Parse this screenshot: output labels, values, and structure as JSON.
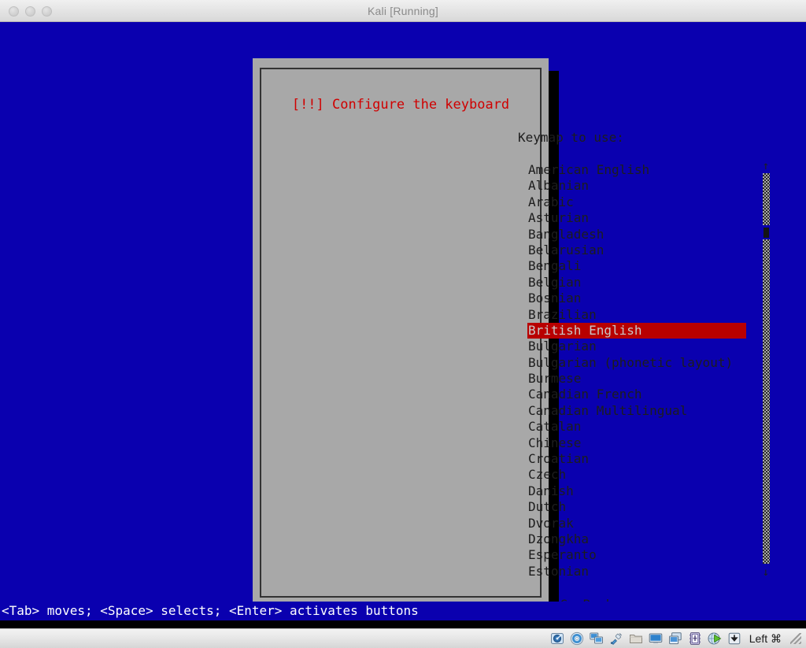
{
  "window": {
    "title": "Kali [Running]",
    "traffic_lights": [
      "close",
      "minimize",
      "zoom"
    ]
  },
  "dialog": {
    "title": "[!!] Configure the keyboard",
    "title_color": "#d00000",
    "prompt": "Keymap to use:",
    "background_color": "#a8a8a8",
    "items": [
      "American English",
      "Albanian",
      "Arabic",
      "Asturian",
      "Bangladesh",
      "Belarusian",
      "Bengali",
      "Belgian",
      "Bosnian",
      "Brazilian",
      "British English",
      "Bulgarian",
      "Bulgarian (phonetic layout)",
      "Burmese",
      "Canadian French",
      "Canadian Multilingual",
      "Catalan",
      "Chinese",
      "Croatian",
      "Czech",
      "Danish",
      "Dutch",
      "Dvorak",
      "Dzongkha",
      "Esperanto",
      "Estonian"
    ],
    "selected_item": "British English",
    "selected_index": 10,
    "selection_color": "#b80000",
    "scrollbar": {
      "up_arrow": "↑",
      "down_arrow": "↓"
    },
    "buttons": [
      {
        "label": "<Go Back>"
      }
    ]
  },
  "status_bar": {
    "text": "<Tab> moves; <Space> selects; <Enter> activates buttons",
    "background_color": "#0a00af",
    "text_color": "#ffffff"
  },
  "desktop": {
    "background_color": "#0a00af"
  },
  "vbox_toolbar": {
    "icons": [
      "hard-disk-icon",
      "optical-disc-icon",
      "network-icon",
      "usb-icon",
      "shared-folders-icon",
      "display-icon",
      "video-capture-icon",
      "cpu-icon",
      "remote-desktop-icon",
      "host-key-indicator-icon"
    ],
    "host_key": "Left ⌘"
  }
}
